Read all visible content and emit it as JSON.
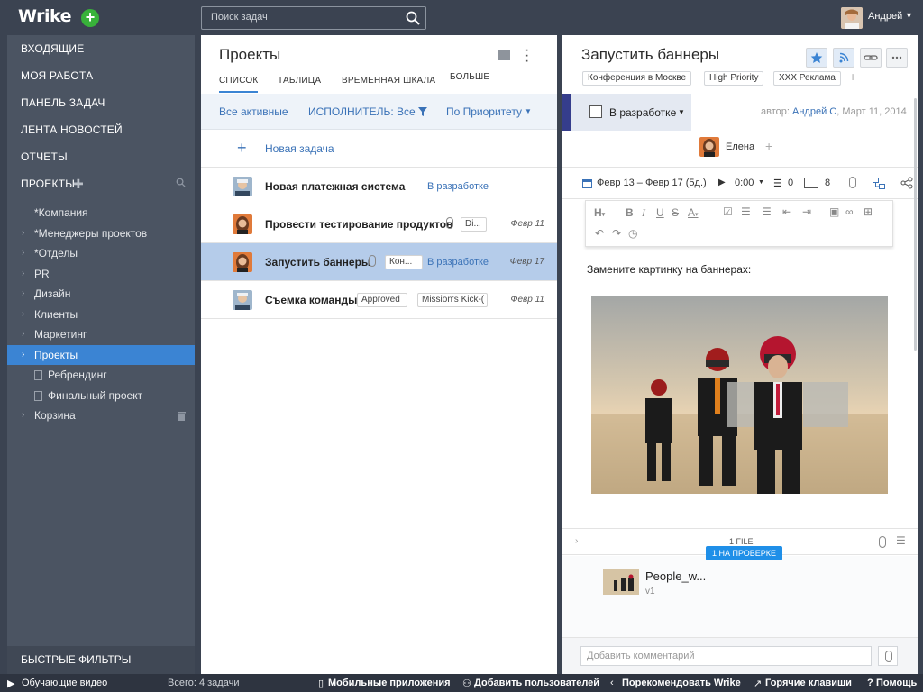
{
  "app": {
    "logo": "Wrike",
    "new_button": "+"
  },
  "search": {
    "placeholder": "Поиск задач"
  },
  "user": {
    "name": "Андрей"
  },
  "sidebar": {
    "nav": [
      "ВХОДЯЩИЕ",
      "МОЯ РАБОТА",
      "ПАНЕЛЬ ЗАДАЧ",
      "ЛЕНТА НОВОСТЕЙ",
      "ОТЧЕТЫ"
    ],
    "projects_label": "ПРОЕКТЫ",
    "tree": [
      {
        "label": "*Компания",
        "chevron": false
      },
      {
        "label": "*Менеджеры проектов",
        "chevron": true
      },
      {
        "label": "*Отделы",
        "chevron": true
      },
      {
        "label": "PR",
        "chevron": true
      },
      {
        "label": "Дизайн",
        "chevron": true
      },
      {
        "label": "Клиенты",
        "chevron": true
      },
      {
        "label": "Маркетинг",
        "chevron": true
      },
      {
        "label": "Проекты",
        "chevron": true,
        "selected": true
      },
      {
        "label": "Ребрендинг",
        "doc": true
      },
      {
        "label": "Финальный проект",
        "doc": true
      },
      {
        "label": "Корзина",
        "chevron": true,
        "trash": true
      }
    ],
    "quick_filters": "БЫСТРЫЕ ФИЛЬТРЫ"
  },
  "list": {
    "title": "Проекты",
    "tabs": [
      "СПИСОК",
      "ТАБЛИЦА",
      "ВРЕМЕННАЯ ШКАЛА",
      "БОЛЬШЕ"
    ],
    "filters": {
      "active": "Все активные",
      "assignee": "ИСПОЛНИТЕЛЬ: Все",
      "sort": "По Приоритету"
    },
    "new_task": "Новая задача",
    "tasks": [
      {
        "name": "Новая платежная система",
        "status": "В разработке",
        "tag": "",
        "date": ""
      },
      {
        "name": "Провести тестирование продуктов",
        "status": "",
        "tag": "Di...",
        "date": "Февр 11"
      },
      {
        "name": "Запустить баннеры",
        "status": "В разработке",
        "tag": "Кон...",
        "date": "Февр 17"
      },
      {
        "name": "Съемка команды",
        "status": "",
        "tag": "Approved",
        "tag2": "Mission's Kick-(",
        "date": "Февр 11"
      }
    ]
  },
  "detail": {
    "title": "Запустить баннеры",
    "tags": [
      "Конференция в Москве",
      "High Priority",
      "XXX Реклама"
    ],
    "status": "В разработке",
    "author_prefix": "автор:",
    "author": "Андрей С",
    "author_date": ", Март 11, 2014",
    "assignee": "Елена",
    "dates": "Февр 13 – Февр 17 (5д.)",
    "time": "0:00",
    "subtasks": "0",
    "pages": "8",
    "description": "Замените картинку на баннерах:",
    "files_count": "1 FILE",
    "review_badge": "1 НА ПРОВЕРКЕ",
    "file_name": "People_w...",
    "file_version": "v1",
    "comment_placeholder": "Добавить комментарий"
  },
  "footer": {
    "video": "Обучающие видео",
    "total": "Всего: 4 задачи",
    "mobile": "Мобильные приложения",
    "add_users": "Добавить пользователей",
    "recommend": "Порекомендовать Wrike",
    "hotkeys": "Горячие клавиши",
    "help": "Помощь"
  },
  "colors": {
    "accent": "#3b84d3",
    "selected_row": "#b5ccea",
    "status_bar": "#353d8c",
    "brand_plus": "#38b23a"
  }
}
